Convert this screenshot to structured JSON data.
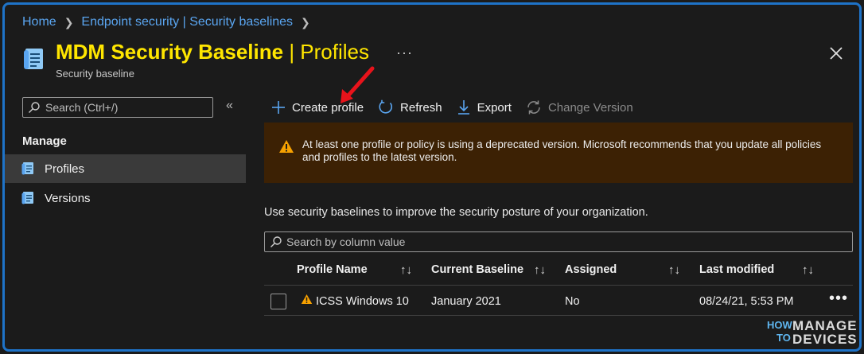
{
  "breadcrumb": {
    "items": [
      "Home",
      "Endpoint security | Security baselines"
    ]
  },
  "header": {
    "title_main": "MDM Security Baseline",
    "title_sep": " | ",
    "title_tail": "Profiles",
    "subtitle": "Security baseline",
    "more": "···",
    "icon": "document-list-icon",
    "close_icon": "close-icon"
  },
  "sidebar": {
    "search_placeholder": "Search (Ctrl+/)",
    "collapse": "«",
    "section": "Manage",
    "items": [
      {
        "label": "Profiles",
        "active": true
      },
      {
        "label": "Versions",
        "active": false
      }
    ]
  },
  "toolbar": {
    "create": "Create profile",
    "refresh": "Refresh",
    "export": "Export",
    "change_version": "Change Version"
  },
  "warning": {
    "text": "At least one profile or policy is using a deprecated version. Microsoft recommends that you update all policies and profiles to the latest version."
  },
  "intro": "Use security baselines to improve the security posture of your organization.",
  "table": {
    "search_placeholder": "Search by column value",
    "columns": [
      "Profile Name",
      "Current Baseline",
      "Assigned",
      "Last modified"
    ],
    "sort_glyph": "↑↓",
    "rows": [
      {
        "name": "ICSS Windows 10",
        "baseline": "January 2021",
        "assigned": "No",
        "modified": "08/24/21, 5:53 PM",
        "more": "•••"
      }
    ]
  },
  "logo": {
    "how": "HOW",
    "to": "TO",
    "manage": "MANAGE",
    "devices": "DEVICES"
  },
  "colors": {
    "accent_link": "#5aa5f0",
    "title_highlight": "#ffe600",
    "warning_bg": "#3c2104",
    "warning_icon": "#f7a100",
    "arrow": "#e8131b",
    "frame": "#1e73c8"
  }
}
